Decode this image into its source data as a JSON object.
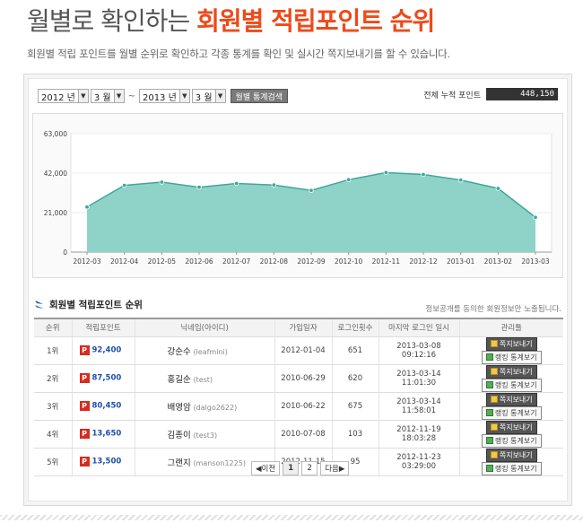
{
  "header": {
    "title_plain": "월별로 확인하는",
    "title_accent": "회원별 적립포인트 순위",
    "subtitle": "회원별 적립 포인트를 월별 순위로 확인하고 각종 통계를 확인 및 실시간 쪽지보내기를 할 수 있습니다."
  },
  "filter": {
    "from_year": "2012 년",
    "from_month": "3 월",
    "separator": "~",
    "to_year": "2013 년",
    "to_month": "3 월",
    "search_label": "월별 통계검색"
  },
  "total": {
    "label": "전체 누적 포인트",
    "value": "448,150"
  },
  "chart_data": {
    "type": "area",
    "categories": [
      "2012-03",
      "2012-04",
      "2012-05",
      "2012-06",
      "2012-07",
      "2012-08",
      "2012-09",
      "2012-10",
      "2012-11",
      "2012-12",
      "2013-01",
      "2013-02",
      "2013-03"
    ],
    "values": [
      24000,
      35500,
      37200,
      34500,
      36500,
      35700,
      32800,
      38500,
      42300,
      41300,
      38300,
      33900,
      18500
    ],
    "yticks": [
      "63,000",
      "42,000",
      "21,000",
      "0"
    ],
    "ytick_values": [
      63000,
      42000,
      21000,
      0
    ],
    "ylim": [
      0,
      63000
    ],
    "fill_color": "#8fd3c8",
    "line_color": "#3fa896",
    "grid": true
  },
  "ranking": {
    "title": "회원별 적립포인트 순위",
    "notice": "정보공개를 동의한 회원정보만 노출됩니다.",
    "columns": [
      "순위",
      "적립포인트",
      "닉네임(아이디)",
      "가입일자",
      "로그인횟수",
      "마지막 로그인 일시",
      "관리툴"
    ],
    "badge": "P",
    "message_label": "쪽지보내기",
    "stats_label": "랭킹 통계보기",
    "rows": [
      {
        "rank": "1위",
        "points": "92,400",
        "name": "강순수",
        "id": "(leafmini)",
        "joined": "2012-01-04",
        "logins": "651",
        "last": "2013-03-08 09:12:16"
      },
      {
        "rank": "2위",
        "points": "87,500",
        "name": "홍길순",
        "id": "(test)",
        "joined": "2010-06-29",
        "logins": "620",
        "last": "2013-03-14 11:01:30"
      },
      {
        "rank": "3위",
        "points": "80,450",
        "name": "배영암",
        "id": "(dalgo2622)",
        "joined": "2010-06-22",
        "logins": "675",
        "last": "2013-03-14 11:58:01"
      },
      {
        "rank": "4위",
        "points": "13,650",
        "name": "김종이",
        "id": "(test3)",
        "joined": "2010-07-08",
        "logins": "103",
        "last": "2012-11-19 18:03:28"
      },
      {
        "rank": "5위",
        "points": "13,500",
        "name": "그랜지",
        "id": "(manson1225)",
        "joined": "2012-11-15",
        "logins": "95",
        "last": "2012-11-23 03:29:00"
      }
    ]
  },
  "pager": {
    "prev": "◀이전",
    "pages": [
      "1",
      "2"
    ],
    "next": "다음▶"
  }
}
